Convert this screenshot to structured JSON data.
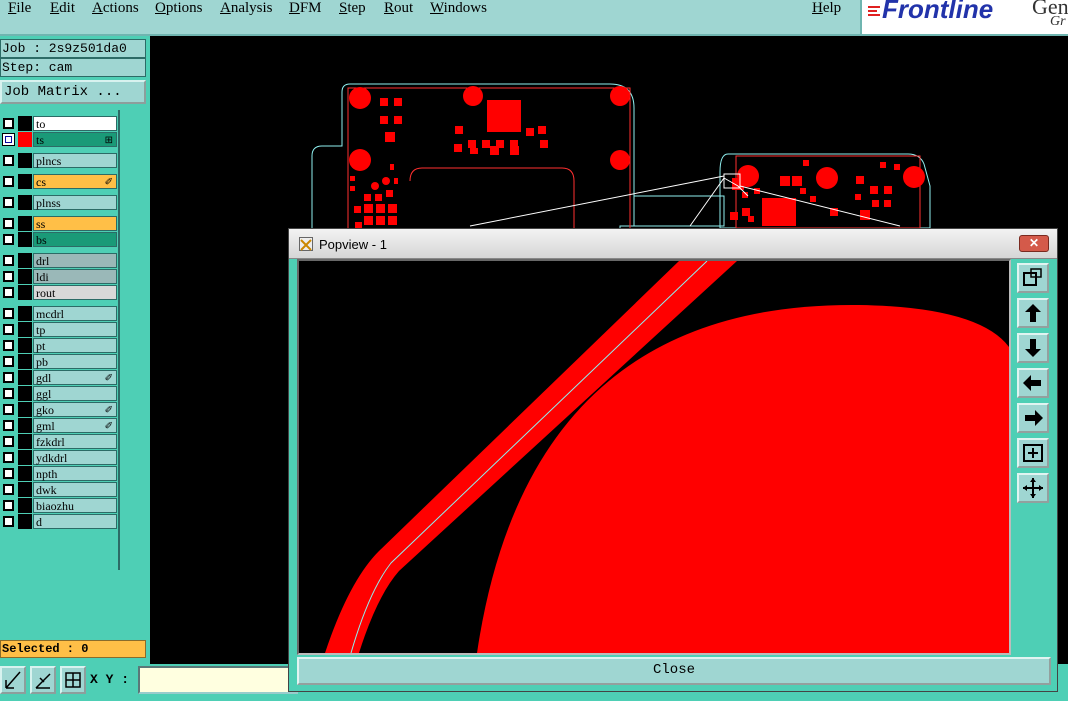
{
  "menu": {
    "items": [
      "File",
      "Edit",
      "Actions",
      "Options",
      "Analysis",
      "DFM",
      "Step",
      "Rout",
      "Windows"
    ],
    "help": "Help"
  },
  "logo": {
    "name": "Frontline",
    "suffix": "Gen",
    "sub": "Gr"
  },
  "job": {
    "label": "Job : 2s9z501da0",
    "step": "Step: cam"
  },
  "job_matrix_button": "Job Matrix ...",
  "layers": [
    {
      "name": "to",
      "color": "#ffffff",
      "swatch": "#000000",
      "checked": false,
      "edit": ""
    },
    {
      "name": "ts",
      "color": "#1a9a78",
      "swatch": "#ff0000",
      "checked": true,
      "edit": "⊞"
    },
    {
      "name": "plncs",
      "color": "#9fd6d2",
      "swatch": "#000000",
      "checked": false,
      "edit": ""
    },
    {
      "name": "cs",
      "color": "#ffbf47",
      "swatch": "#000000",
      "checked": false,
      "edit": "✐"
    },
    {
      "name": "plnss",
      "color": "#9fd6d2",
      "swatch": "#000000",
      "checked": false,
      "edit": ""
    },
    {
      "name": "ss",
      "color": "#ffbf47",
      "swatch": "#000000",
      "checked": false,
      "edit": ""
    },
    {
      "name": "bs",
      "color": "#1a9a78",
      "swatch": "#000000",
      "checked": false,
      "edit": ""
    },
    {
      "name": "drl",
      "color": "#9ab8b8",
      "swatch": "#000000",
      "checked": false,
      "edit": ""
    },
    {
      "name": "ldi",
      "color": "#9ab8b8",
      "swatch": "#000000",
      "checked": false,
      "edit": ""
    },
    {
      "name": "rout",
      "color": "#d8d8d8",
      "swatch": "#000000",
      "checked": false,
      "edit": ""
    },
    {
      "name": "mcdrl",
      "color": "#9fd6d2",
      "swatch": "#000000",
      "checked": false,
      "edit": ""
    },
    {
      "name": "tp",
      "color": "#9fd6d2",
      "swatch": "#000000",
      "checked": false,
      "edit": ""
    },
    {
      "name": "pt",
      "color": "#9fd6d2",
      "swatch": "#000000",
      "checked": false,
      "edit": ""
    },
    {
      "name": "pb",
      "color": "#9fd6d2",
      "swatch": "#000000",
      "checked": false,
      "edit": ""
    },
    {
      "name": "gdl",
      "color": "#9fd6d2",
      "swatch": "#000000",
      "checked": false,
      "edit": "✐"
    },
    {
      "name": "ggl",
      "color": "#9fd6d2",
      "swatch": "#000000",
      "checked": false,
      "edit": ""
    },
    {
      "name": "gko",
      "color": "#9fd6d2",
      "swatch": "#000000",
      "checked": false,
      "edit": "✐"
    },
    {
      "name": "gml",
      "color": "#9fd6d2",
      "swatch": "#000000",
      "checked": false,
      "edit": "✐"
    },
    {
      "name": "fzkdrl",
      "color": "#9fd6d2",
      "swatch": "#000000",
      "checked": false,
      "edit": ""
    },
    {
      "name": "ydkdrl",
      "color": "#9fd6d2",
      "swatch": "#000000",
      "checked": false,
      "edit": ""
    },
    {
      "name": "npth",
      "color": "#9fd6d2",
      "swatch": "#000000",
      "checked": false,
      "edit": ""
    },
    {
      "name": "dwk",
      "color": "#9fd6d2",
      "swatch": "#000000",
      "checked": false,
      "edit": ""
    },
    {
      "name": "biaozhu",
      "color": "#9fd6d2",
      "swatch": "#000000",
      "checked": false,
      "edit": ""
    },
    {
      "name": "d",
      "color": "#9fd6d2",
      "swatch": "#000000",
      "checked": false,
      "edit": ""
    }
  ],
  "selected": "Selected : 0",
  "xy_label": "X Y :",
  "xy_value": "",
  "popup": {
    "title": "Popview - 1",
    "close_label": "Close",
    "tools": [
      "zoom-window-icon",
      "pan-up-icon",
      "pan-down-icon",
      "pan-left-icon",
      "pan-right-icon",
      "zoom-fit-icon",
      "zoom-center-icon"
    ]
  },
  "colors": {
    "panel": "#4ecfb5",
    "button": "#9fd6d2",
    "copper": "#ff0000",
    "outline": "#8ff0f0"
  }
}
